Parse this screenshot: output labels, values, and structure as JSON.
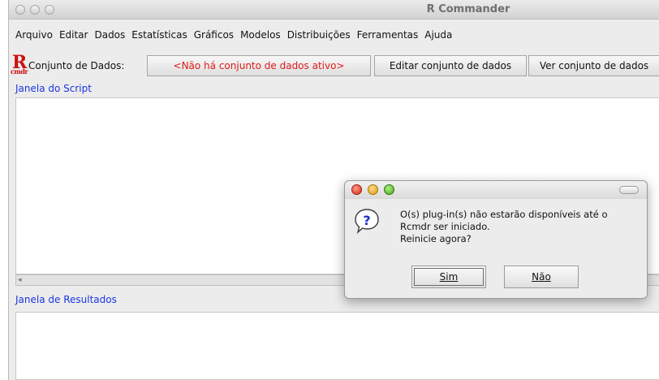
{
  "window": {
    "title": "R Commander"
  },
  "menubar": {
    "items": [
      "Arquivo",
      "Editar",
      "Dados",
      "Estatísticas",
      "Gráficos",
      "Modelos",
      "Distribuições",
      "Ferramentas",
      "Ajuda"
    ]
  },
  "toolbar": {
    "logo_main": "R",
    "logo_sub": "cmdr",
    "dataset_label": "Conjunto de Dados:",
    "dataset_value": "<Não há conjunto de dados ativo>",
    "edit_dataset_label": "Editar conjunto de dados",
    "view_dataset_label": "Ver conjunto de dados"
  },
  "script": {
    "label": "Janela do Script"
  },
  "results": {
    "label": "Janela de Resultados"
  },
  "dialog": {
    "message": "O(s) plug-in(s) não estarão disponíveis até o\nRcmdr ser iniciado.\n Reinicie agora?",
    "yes_label": "Sim",
    "no_label": "Não",
    "icon": "question-icon"
  },
  "colors": {
    "dataset_value": "#e01a1a",
    "section_label": "#1a35e0",
    "logo": "#cc1111"
  }
}
